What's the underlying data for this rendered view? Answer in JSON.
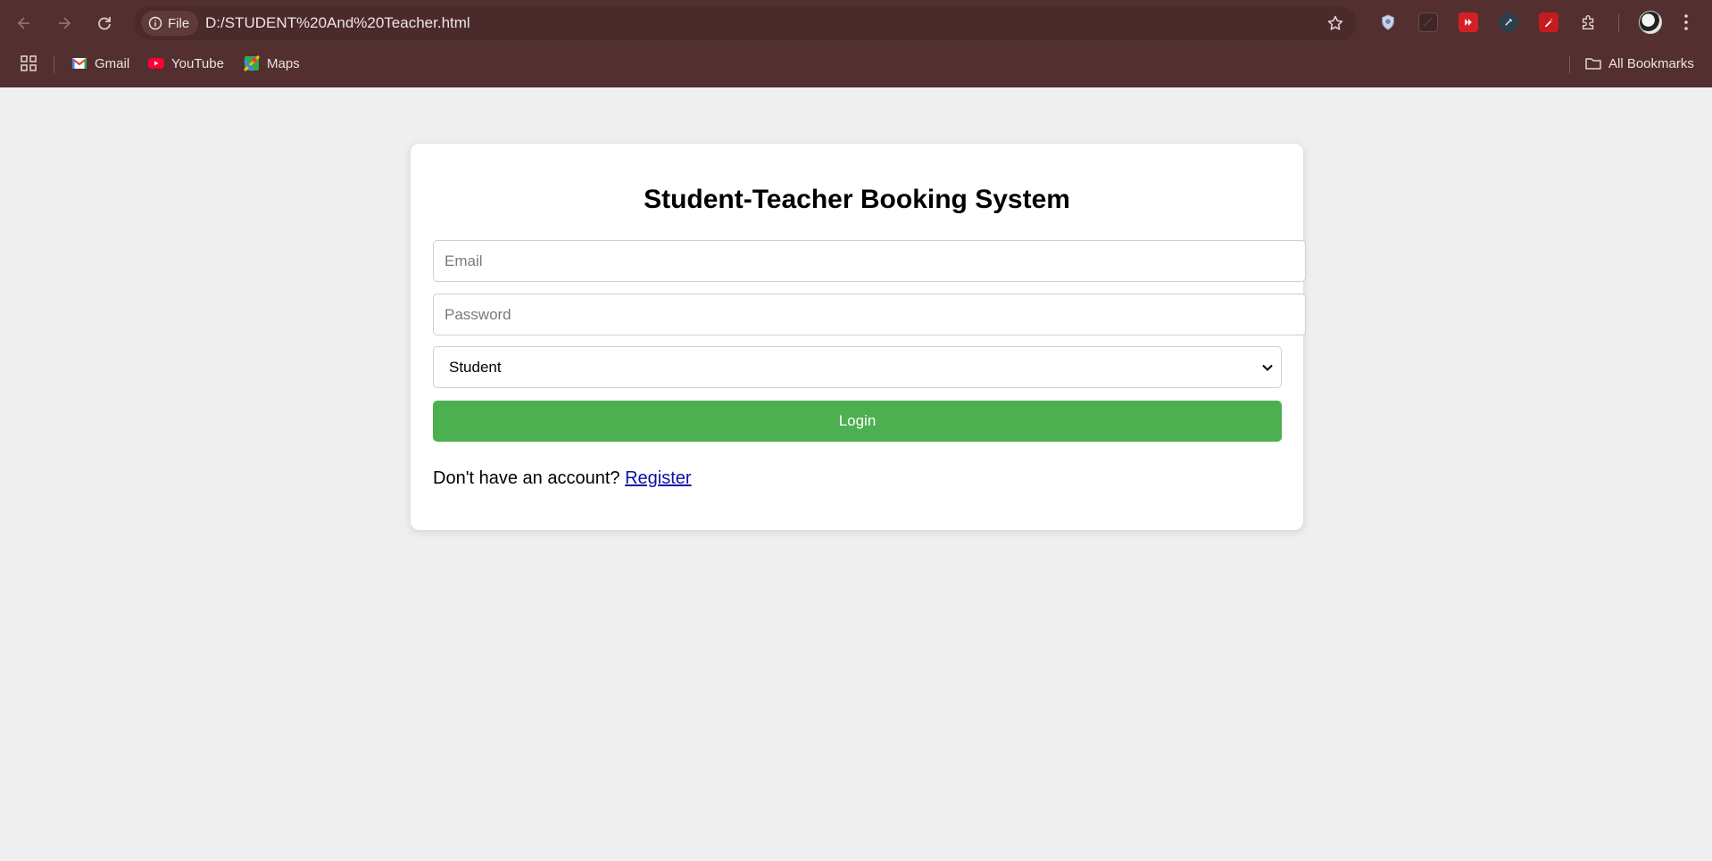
{
  "browser": {
    "site_chip_label": "File",
    "url": "D:/STUDENT%20And%20Teacher.html",
    "bookmarks": [
      {
        "label": "Gmail",
        "icon": "gmail-icon"
      },
      {
        "label": "YouTube",
        "icon": "youtube-icon"
      },
      {
        "label": "Maps",
        "icon": "maps-icon"
      }
    ],
    "all_bookmarks_label": "All Bookmarks",
    "theme_color": "#532f2f"
  },
  "login": {
    "title": "Student-Teacher Booking System",
    "email_placeholder": "Email",
    "password_placeholder": "Password",
    "role_selected": "Student",
    "login_button_label": "Login",
    "register_prompt": "Don't have an account?",
    "register_link_label": "Register",
    "accent_color": "#4caf50",
    "link_color": "#0b11a5"
  }
}
